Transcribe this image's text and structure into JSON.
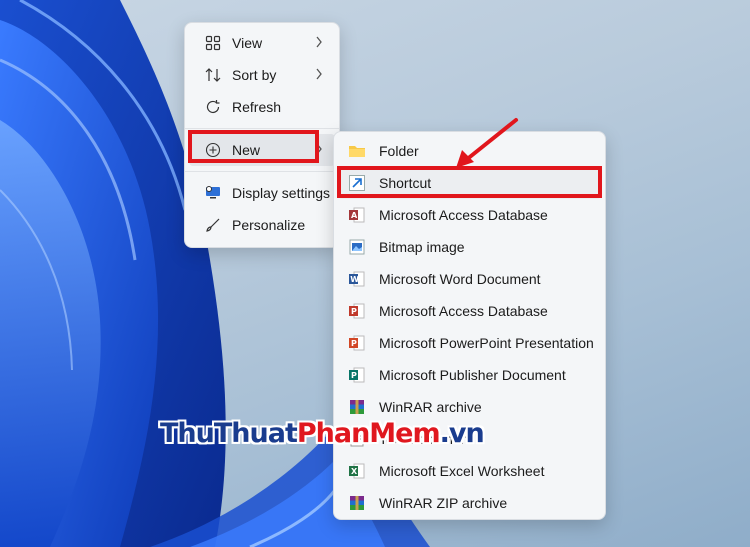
{
  "context_menu": {
    "items": [
      {
        "label": "View",
        "icon": "grid-icon",
        "has_submenu": true
      },
      {
        "label": "Sort by",
        "icon": "sort-icon",
        "has_submenu": true
      },
      {
        "label": "Refresh",
        "icon": "refresh-icon",
        "has_submenu": false
      },
      {
        "label": "New",
        "icon": "plus-circle-icon",
        "has_submenu": true
      },
      {
        "label": "Display settings",
        "icon": "display-icon",
        "has_submenu": false
      },
      {
        "label": "Personalize",
        "icon": "brush-icon",
        "has_submenu": false
      }
    ]
  },
  "new_submenu": {
    "items": [
      {
        "label": "Folder",
        "icon": "folder-icon"
      },
      {
        "label": "Shortcut",
        "icon": "shortcut-icon"
      },
      {
        "label": "Microsoft Access Database",
        "icon": "access-icon"
      },
      {
        "label": "Bitmap image",
        "icon": "bitmap-icon"
      },
      {
        "label": "Microsoft Word Document",
        "icon": "word-icon"
      },
      {
        "label": "Microsoft Access Database",
        "icon": "access-icon"
      },
      {
        "label": "Microsoft PowerPoint Presentation",
        "icon": "powerpoint-icon"
      },
      {
        "label": "Microsoft Publisher Document",
        "icon": "publisher-icon"
      },
      {
        "label": "WinRAR archive",
        "icon": "winrar-icon"
      },
      {
        "label": "Text Document",
        "icon": "text-document-icon"
      },
      {
        "label": "Microsoft Excel Worksheet",
        "icon": "excel-icon"
      },
      {
        "label": "WinRAR ZIP archive",
        "icon": "winrar-zip-icon"
      }
    ]
  },
  "annotation": {
    "arrow_color": "#e1161c",
    "highlight_color": "#e1161c"
  },
  "watermark": {
    "part1": "ThuThuat",
    "part2": "PhanMem",
    "part3": ".vn"
  }
}
